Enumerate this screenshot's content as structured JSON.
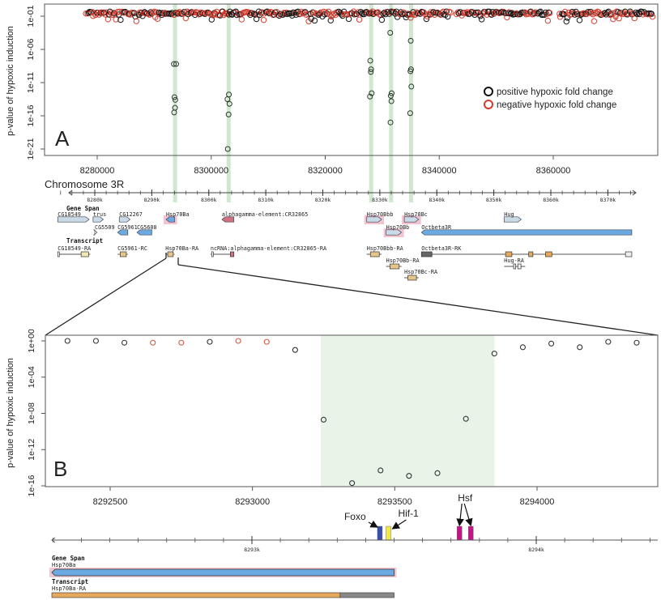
{
  "chart_data": [
    {
      "id": "A",
      "type": "scatter",
      "panel_label": "A",
      "title": "",
      "xlabel": "Chromosome 3R",
      "ylabel": "p-value of hypoxic induction",
      "xlim": [
        8272000,
        8385000
      ],
      "ylim_log10": [
        -21.5,
        0
      ],
      "y_scale": "log",
      "x_ticks": [
        8280000,
        8300000,
        8320000,
        8340000,
        8360000
      ],
      "x_tick_labels": [
        "8280000",
        "8300000",
        "8320000",
        "8340000",
        "8360000"
      ],
      "y_ticks_log10": [
        -1,
        -6,
        -11,
        -16,
        -21
      ],
      "y_tick_labels": [
        "1e-01",
        "1e-06",
        "1e-11",
        "1e-16",
        "1e-21"
      ],
      "grid": false,
      "legend": {
        "placement": "right",
        "entries": [
          {
            "label": "positive hypoxic fold change",
            "color": "#111111"
          },
          {
            "label": "negative hypoxic fold change",
            "color": "#d33a2c"
          }
        ]
      },
      "highlight_regions": [
        {
          "x0": 8293300,
          "x1": 8294000
        },
        {
          "x0": 8302700,
          "x1": 8303300
        },
        {
          "x0": 8327700,
          "x1": 8328300
        },
        {
          "x0": 8331200,
          "x1": 8331800
        },
        {
          "x0": 8334700,
          "x1": 8335300
        }
      ],
      "highlight_color": "#c8e3c8",
      "background_band": {
        "x_ranges": [
          [
            8278000,
            8300500
          ],
          [
            8300500,
            8342000
          ],
          [
            8343000,
            8359500
          ],
          [
            8361000,
            8377500
          ]
        ],
        "log10_p_range": [
          -0.3,
          -1.8
        ],
        "note": "dense cluster of non-significant points along the top, both fold-change directions"
      },
      "series": [
        {
          "name": "positive hypoxic fold change",
          "color": "#111111",
          "points": [
            {
              "x": 8293450,
              "log10p": -8.2
            },
            {
              "x": 8293850,
              "log10p": -8.2
            },
            {
              "x": 8293550,
              "log10p": -13.2
            },
            {
              "x": 8293700,
              "log10p": -13.6
            },
            {
              "x": 8293650,
              "log10p": -14.8
            },
            {
              "x": 8293500,
              "log10p": -15.5
            },
            {
              "x": 8303100,
              "log10p": -12.8
            },
            {
              "x": 8302850,
              "log10p": -13.5
            },
            {
              "x": 8303200,
              "log10p": -14.2
            },
            {
              "x": 8303050,
              "log10p": -15.8
            },
            {
              "x": 8302900,
              "log10p": -21.0
            },
            {
              "x": 8327900,
              "log10p": -7.7
            },
            {
              "x": 8328050,
              "log10p": -9.0
            },
            {
              "x": 8328000,
              "log10p": -9.4
            },
            {
              "x": 8328150,
              "log10p": -12.6
            },
            {
              "x": 8327850,
              "log10p": -13.1
            },
            {
              "x": 8331400,
              "log10p": -3.5
            },
            {
              "x": 8331650,
              "log10p": -12.6
            },
            {
              "x": 8331500,
              "log10p": -13.0
            },
            {
              "x": 8331600,
              "log10p": -13.8
            },
            {
              "x": 8331450,
              "log10p": -17.0
            },
            {
              "x": 8335000,
              "log10p": -4.7
            },
            {
              "x": 8335050,
              "log10p": -9.0
            },
            {
              "x": 8334950,
              "log10p": -9.3
            },
            {
              "x": 8335100,
              "log10p": -11.6
            },
            {
              "x": 8334900,
              "log10p": -15.6
            }
          ]
        },
        {
          "name": "negative hypoxic fold change",
          "color": "#d33a2c",
          "points": []
        }
      ]
    },
    {
      "id": "B",
      "type": "scatter",
      "panel_label": "B",
      "title": "",
      "xlabel": "",
      "ylabel": "p-value of hypoxic induction",
      "xlim": [
        8292270,
        8294500
      ],
      "ylim_log10": [
        -16,
        0.5
      ],
      "y_scale": "log",
      "x_ticks": [
        8292500,
        8293000,
        8293500,
        8294000
      ],
      "x_tick_labels": [
        "8292500",
        "8293000",
        "8293500",
        "8294000"
      ],
      "y_ticks_log10": [
        0,
        -4,
        -8,
        -12,
        -16
      ],
      "y_tick_labels": [
        "1e+00",
        "1e-04",
        "1e-08",
        "1e-12",
        "1e-16"
      ],
      "grid": false,
      "highlight_regions": [
        {
          "x0": 8293240,
          "x1": 8293850
        }
      ],
      "highlight_color": "#e8f4e8",
      "series": [
        {
          "name": "positive hypoxic fold change",
          "color": "#333333",
          "points": [
            {
              "x": 8292350,
              "log10p": 0.0
            },
            {
              "x": 8292450,
              "log10p": 0.0
            },
            {
              "x": 8292550,
              "log10p": -0.2
            },
            {
              "x": 8292850,
              "log10p": -0.1
            },
            {
              "x": 8293150,
              "log10p": -1.0
            },
            {
              "x": 8293250,
              "log10p": -8.7
            },
            {
              "x": 8293350,
              "log10p": -15.7
            },
            {
              "x": 8293450,
              "log10p": -14.3
            },
            {
              "x": 8293550,
              "log10p": -14.9
            },
            {
              "x": 8293650,
              "log10p": -14.6
            },
            {
              "x": 8293750,
              "log10p": -8.6
            },
            {
              "x": 8293850,
              "log10p": -1.4
            },
            {
              "x": 8293950,
              "log10p": -0.7
            },
            {
              "x": 8294050,
              "log10p": -0.3
            },
            {
              "x": 8294150,
              "log10p": -0.7
            },
            {
              "x": 8294250,
              "log10p": -0.1
            },
            {
              "x": 8294350,
              "log10p": -0.2
            }
          ]
        },
        {
          "name": "negative hypoxic fold change",
          "color": "#d0573f",
          "points": [
            {
              "x": 8292650,
              "log10p": -0.2
            },
            {
              "x": 8292750,
              "log10p": -0.2
            },
            {
              "x": 8292950,
              "log10p": 0.0
            },
            {
              "x": 8293050,
              "log10p": -0.1
            }
          ]
        }
      ]
    }
  ],
  "genome_browser_overview": {
    "ruler_ticks": [
      "8280k",
      "8290k",
      "8300k",
      "8310k",
      "8320k",
      "8330k",
      "8340k",
      "8350k",
      "8360k",
      "8370k"
    ],
    "ruler_range": [
      8273000,
      8375000
    ],
    "gene_span_title": "Gene Span",
    "transcript_title": "Transcript",
    "gene_spans": [
      {
        "label": "CG18549",
        "start": 8273500,
        "end": 8279000,
        "strand": "+",
        "row": 0,
        "color": "#c9dbe6",
        "highlight": false
      },
      {
        "label": "trus",
        "start": 8279700,
        "end": 8281500,
        "strand": "+",
        "row": 0,
        "color": "#c9dbe6",
        "highlight": false
      },
      {
        "label": "CG12267",
        "start": 8284300,
        "end": 8286200,
        "strand": "+",
        "row": 0,
        "color": "#c9dbe6",
        "highlight": false
      },
      {
        "label": "Hsp70Ba",
        "start": 8292500,
        "end": 8294000,
        "strand": "-",
        "row": 0,
        "color": "#6aaae0",
        "highlight": true
      },
      {
        "label": "alphagamma-element:CR32865",
        "start": 8302300,
        "end": 8304400,
        "strand": "-",
        "row": 0,
        "color": "#d07080",
        "highlight": false
      },
      {
        "label": "CG5509",
        "start": 8280000,
        "end": 8280400,
        "strand": "+",
        "row": 1,
        "color": "#ffffff",
        "highlight": false
      },
      {
        "label": "CG5961",
        "start": 8284000,
        "end": 8285800,
        "strand": "-",
        "row": 1,
        "color": "#6aaae0",
        "highlight": false
      },
      {
        "label": "CG5608",
        "start": 8287400,
        "end": 8290000,
        "strand": "-",
        "row": 1,
        "color": "#6aaae0",
        "highlight": false
      },
      {
        "label": "Hsp70Bbb",
        "start": 8327700,
        "end": 8330300,
        "strand": "+",
        "row": 0,
        "color": "#c9dbe6",
        "highlight": true
      },
      {
        "label": "Hsp70Bc",
        "start": 8334300,
        "end": 8336800,
        "strand": "+",
        "row": 0,
        "color": "#c9dbe6",
        "highlight": true
      },
      {
        "label": "Hug",
        "start": 8351800,
        "end": 8354800,
        "strand": "+",
        "row": 0,
        "color": "#c9dbe6",
        "highlight": false
      },
      {
        "label": "Hsp70Bb",
        "start": 8331100,
        "end": 8333800,
        "strand": "+",
        "row": 1,
        "color": "#c9dbe6",
        "highlight": true
      },
      {
        "label": "Octbeta3R",
        "start": 8337300,
        "end": 8374200,
        "strand": "-",
        "row": 1,
        "color": "#6aaae0",
        "highlight": false
      }
    ],
    "transcripts": [
      {
        "label": "CG18549-RA",
        "start": 8273500,
        "end": 8279200,
        "strand": "+",
        "row": 0
      },
      {
        "label": "CG5961-RC",
        "start": 8284000,
        "end": 8285800,
        "strand": "-",
        "row": 0
      },
      {
        "label": "Hsp70Ba-RA",
        "start": 8292400,
        "end": 8294000,
        "strand": "-",
        "row": 0
      },
      {
        "label": "ncRNA:alphagamma-element:CR32865-RA",
        "start": 8300300,
        "end": 8304400,
        "strand": "-",
        "row": 0
      },
      {
        "label": "Hsp70Bbb-RA",
        "start": 8327700,
        "end": 8330300,
        "strand": "+",
        "row": 0
      },
      {
        "label": "Octbeta3R-RK",
        "start": 8337300,
        "end": 8374200,
        "strand": "-",
        "row": 0
      },
      {
        "label": "Hsp70Bb-RA",
        "start": 8331100,
        "end": 8333800,
        "strand": "+",
        "row": 1
      },
      {
        "label": "Hug-RA",
        "start": 8351800,
        "end": 8355500,
        "strand": "+",
        "row": 1
      },
      {
        "label": "Hsp70Bc-RA",
        "start": 8334300,
        "end": 8336800,
        "strand": "+",
        "row": 2
      }
    ]
  },
  "genome_browser_zoom": {
    "ruler_ticks": [
      "8293k",
      "8294k"
    ],
    "ruler_range": [
      8292300,
      8294400
    ],
    "gene_span_title": "Gene Span",
    "gene_label": "Hsp70Ba",
    "transcript_title": "Transcript",
    "transcript_label": "Hsp70Ba-RA",
    "gene_range": [
      8292300,
      8293500
    ],
    "transcript_cds_end": 8293310,
    "motifs": [
      {
        "label": "Foxo",
        "pos": 8293450,
        "color": "#3a50a8"
      },
      {
        "label": "Hif-1",
        "pos": 8293480,
        "color": "#f4ea3c"
      },
      {
        "label": "Hsf",
        "pos": 8293730,
        "color": "#cc1188"
      },
      {
        "label": "Hsf",
        "pos": 8293770,
        "color": "#cc1188"
      }
    ]
  },
  "colors": {
    "positive": "#111111",
    "negative": "#d33a2c",
    "highlight_green": "#c8e3c8",
    "gene_blue": "#6aaae0",
    "gene_light": "#c9dbe6",
    "exon_orange": "#e6a85a",
    "pink_highlight": "#f2c4cf"
  }
}
